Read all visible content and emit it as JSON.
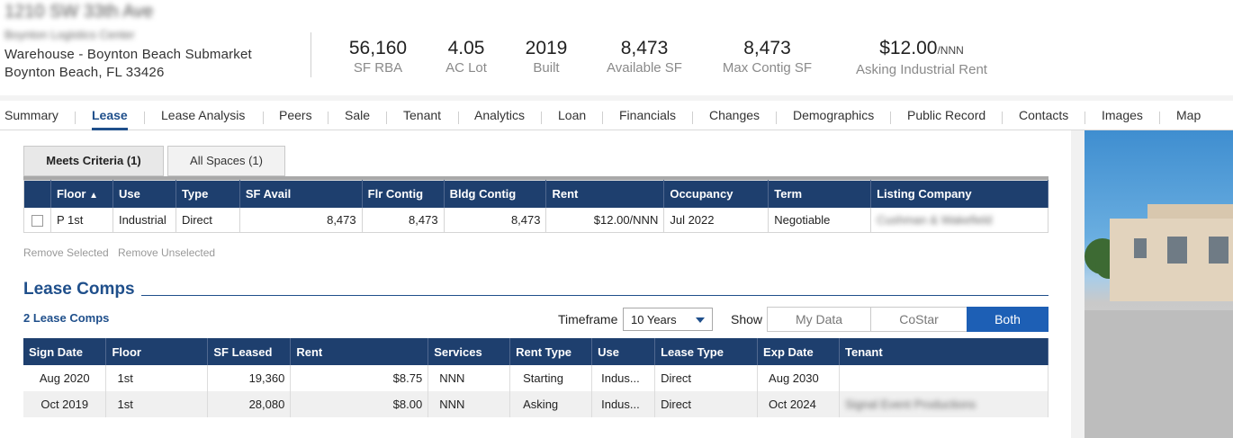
{
  "header": {
    "address": "1210 SW 33th Ave",
    "property_name": "Boynton Logistics Center",
    "type_line": "Warehouse - Boynton Beach Submarket",
    "city_line": "Boynton Beach, FL 33426",
    "stats": [
      {
        "value": "56,160",
        "unit": "",
        "label": "SF RBA"
      },
      {
        "value": "4.05",
        "unit": "",
        "label": "AC Lot"
      },
      {
        "value": "2019",
        "unit": "",
        "label": "Built"
      },
      {
        "value": "8,473",
        "unit": "",
        "label": "Available SF"
      },
      {
        "value": "8,473",
        "unit": "",
        "label": "Max Contig SF"
      },
      {
        "value": "$12.00",
        "unit": "/NNN",
        "label": "Asking Industrial Rent"
      }
    ]
  },
  "tabs": [
    "Summary",
    "Lease",
    "Lease Analysis",
    "Peers",
    "Sale",
    "Tenant",
    "Analytics",
    "Loan",
    "Financials",
    "Changes",
    "Demographics",
    "Public Record",
    "Contacts",
    "Images",
    "Map"
  ],
  "active_tab": "Lease",
  "spaces": {
    "tabs": [
      "Meets Criteria (1)",
      "All Spaces (1)"
    ],
    "columns": [
      "",
      "Floor",
      "Use",
      "Type",
      "SF Avail",
      "Flr Contig",
      "Bldg Contig",
      "Rent",
      "Occupancy",
      "Term",
      "Listing Company"
    ],
    "sort_indicator": "▲",
    "rows": [
      {
        "floor": "P 1st",
        "use": "Industrial",
        "type": "Direct",
        "sf_avail": "8,473",
        "flr_contig": "8,473",
        "bldg_contig": "8,473",
        "rent": "$12.00/NNN",
        "occupancy": "Jul 2022",
        "term": "Negotiable",
        "listing_company": "Cushman & Wakefield"
      }
    ],
    "remove_selected": "Remove Selected",
    "remove_unselected": "Remove Unselected"
  },
  "lease_comps": {
    "title": "Lease Comps",
    "count_label": "2 Lease Comps",
    "timeframe_label": "Timeframe",
    "timeframe_value": "10 Years",
    "show_label": "Show",
    "show_options": [
      "My Data",
      "CoStar",
      "Both"
    ],
    "show_selected": "Both",
    "columns": [
      "Sign Date",
      "Floor",
      "SF Leased",
      "Rent",
      "Services",
      "Rent Type",
      "Use",
      "Lease Type",
      "Exp Date",
      "Tenant"
    ],
    "rows": [
      {
        "sign_date": "Aug 2020",
        "floor": "1st",
        "sf_leased": "19,360",
        "rent": "$8.75",
        "services": "NNN",
        "rent_type": "Starting",
        "use": "Indus...",
        "lease_type": "Direct",
        "exp_date": "Aug 2030",
        "tenant": ""
      },
      {
        "sign_date": "Oct 2019",
        "floor": "1st",
        "sf_leased": "28,080",
        "rent": "$8.00",
        "services": "NNN",
        "rent_type": "Asking",
        "use": "Indus...",
        "lease_type": "Direct",
        "exp_date": "Oct 2024",
        "tenant": "Signal Event Productions"
      }
    ]
  }
}
